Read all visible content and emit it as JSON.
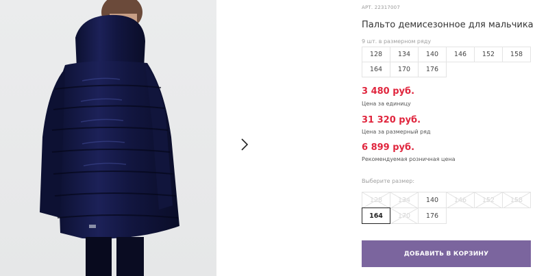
{
  "gallery": {
    "image_alt": "Boy wearing navy long quilted puffer coat, back view",
    "next_icon": "chevron-right-icon"
  },
  "product": {
    "art_label": "АРТ.",
    "art_value": "22317007",
    "title": "Пальто демисезонное для мальчика",
    "row_note": "9 шт. в размерном ряду",
    "size_row": [
      "128",
      "134",
      "140",
      "146",
      "152",
      "158",
      "164",
      "170",
      "176"
    ],
    "prices": [
      {
        "value": "3 480 руб.",
        "label": "Цена за единицу"
      },
      {
        "value": "31 320 руб.",
        "label": "Цена за размерный ряд"
      },
      {
        "value": "6 899 руб.",
        "label": "Рекомендуемая розничная цена"
      }
    ],
    "price_color": "#e0263e"
  },
  "size_select": {
    "label": "Выберите размер:",
    "options": [
      {
        "value": "128",
        "available": false,
        "selected": false
      },
      {
        "value": "134",
        "available": false,
        "selected": false
      },
      {
        "value": "140",
        "available": true,
        "selected": false
      },
      {
        "value": "146",
        "available": false,
        "selected": false
      },
      {
        "value": "152",
        "available": false,
        "selected": false
      },
      {
        "value": "158",
        "available": false,
        "selected": false
      },
      {
        "value": "164",
        "available": true,
        "selected": true
      },
      {
        "value": "170",
        "available": false,
        "selected": false
      },
      {
        "value": "176",
        "available": true,
        "selected": false
      }
    ]
  },
  "cart": {
    "label": "ДОБАВИТЬ В КОРЗИНУ",
    "color": "#7b659e"
  }
}
